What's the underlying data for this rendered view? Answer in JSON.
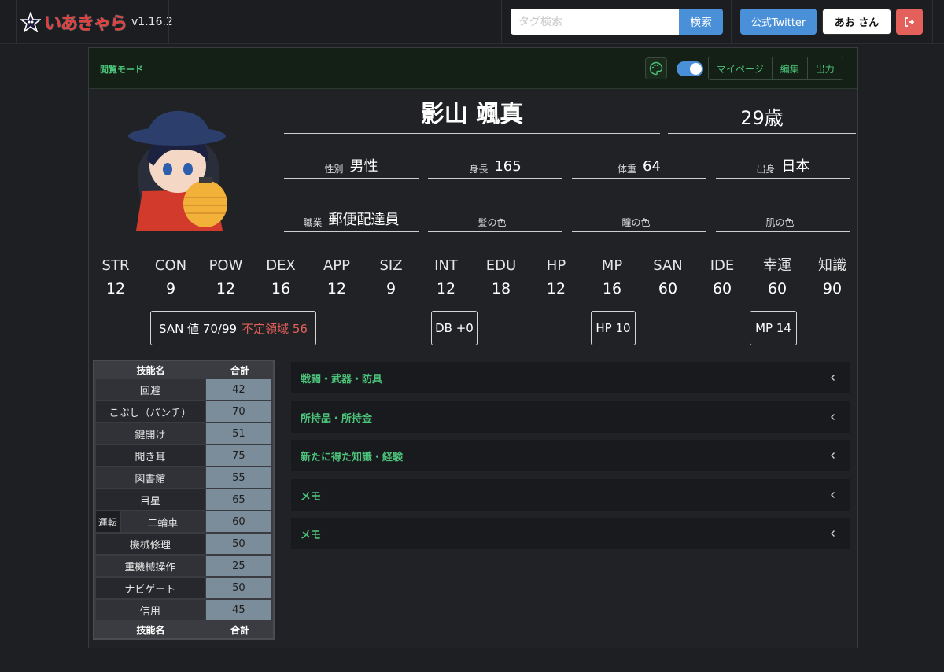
{
  "app": {
    "name": "いあきゃら",
    "version": "v1.16.2"
  },
  "nav": {
    "search_placeholder": "タグ検索",
    "search_label": "検索",
    "twitter_label": "公式Twitter",
    "user_label": "あお さん"
  },
  "card": {
    "mode": "閲覧モード",
    "buttons": [
      "マイページ",
      "編集",
      "出力"
    ]
  },
  "character": {
    "name": "影山 颯真",
    "age": "29歳",
    "info": [
      {
        "label": "性別",
        "value": "男性"
      },
      {
        "label": "身長",
        "value": "165"
      },
      {
        "label": "体重",
        "value": "64"
      },
      {
        "label": "出身",
        "value": "日本"
      },
      {
        "label": "職業",
        "value": "郵便配達員"
      },
      {
        "label": "髪の色",
        "value": ""
      },
      {
        "label": "瞳の色",
        "value": ""
      },
      {
        "label": "肌の色",
        "value": ""
      }
    ]
  },
  "stats": [
    {
      "name": "STR",
      "value": "12"
    },
    {
      "name": "CON",
      "value": "9"
    },
    {
      "name": "POW",
      "value": "12"
    },
    {
      "name": "DEX",
      "value": "16"
    },
    {
      "name": "APP",
      "value": "12"
    },
    {
      "name": "SIZ",
      "value": "9"
    },
    {
      "name": "INT",
      "value": "12"
    },
    {
      "name": "EDU",
      "value": "18"
    },
    {
      "name": "HP",
      "value": "12"
    },
    {
      "name": "MP",
      "value": "16"
    },
    {
      "name": "SAN",
      "value": "60"
    },
    {
      "name": "IDE",
      "value": "60"
    },
    {
      "name": "幸運",
      "value": "60"
    },
    {
      "name": "知識",
      "value": "90"
    }
  ],
  "derived": {
    "san": "SAN 値 70/99",
    "san_unstable": "不定領域",
    "san_unstable_val": "56",
    "db": "DB +0",
    "hp": "HP 10",
    "mp": "MP 14"
  },
  "skills": {
    "header_name": "技能名",
    "header_total": "合計",
    "rows": [
      {
        "name": "回避",
        "value": "42"
      },
      {
        "name": "こぶし（パンチ）",
        "value": "70"
      },
      {
        "name": "鍵開け",
        "value": "51"
      },
      {
        "name": "聞き耳",
        "value": "75"
      },
      {
        "name": "図書館",
        "value": "55"
      },
      {
        "name": "目星",
        "value": "65"
      },
      {
        "name": "二輪車",
        "value": "60",
        "prefix": "運転"
      },
      {
        "name": "機械修理",
        "value": "50"
      },
      {
        "name": "重機械操作",
        "value": "25"
      },
      {
        "name": "ナビゲート",
        "value": "50"
      },
      {
        "name": "信用",
        "value": "45"
      }
    ]
  },
  "sections": [
    "戦闘・武器・防具",
    "所持品・所持金",
    "新たに得た知識・経験",
    "メモ",
    "メモ"
  ],
  "colors": {
    "accent_blue": "#4a90d9",
    "accent_green": "#4cc37a",
    "danger": "#e4605a",
    "brand_red": "#e23d3d"
  }
}
